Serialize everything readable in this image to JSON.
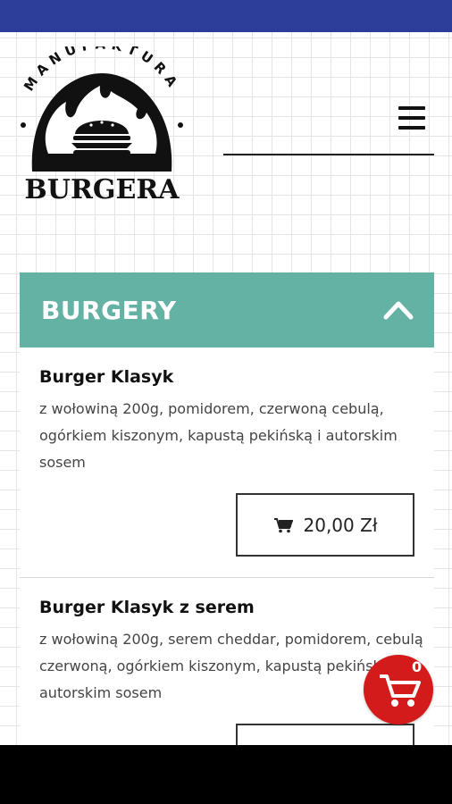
{
  "brand": {
    "top_text": "MANUFAKTURA",
    "bottom_text": "BURGERA"
  },
  "menu": {
    "icon": "hamburger-menu-icon"
  },
  "category": {
    "title": "BURGERY",
    "toggle_icon": "chevron-up-icon"
  },
  "items": [
    {
      "name": "Burger Klasyk",
      "description": "z wołowiną 200g, pomidorem, czerwoną cebulą, ogórkiem kiszonym, kapustą pekińską i autorskim sosem",
      "price": "20,00 Zł"
    },
    {
      "name": "Burger Klasyk z serem",
      "description": "z wołowiną 200g, serem cheddar, pomidorem, cebulą czerwoną, ogórkiem kiszonym, kapustą pekińską i autorskim sosem"
    }
  ],
  "cart": {
    "count": "0",
    "icon": "shopping-cart-icon"
  },
  "colors": {
    "status_bar": "#2c3e9a",
    "category_header": "#64b2a4",
    "cart_button": "#d31b1b"
  }
}
